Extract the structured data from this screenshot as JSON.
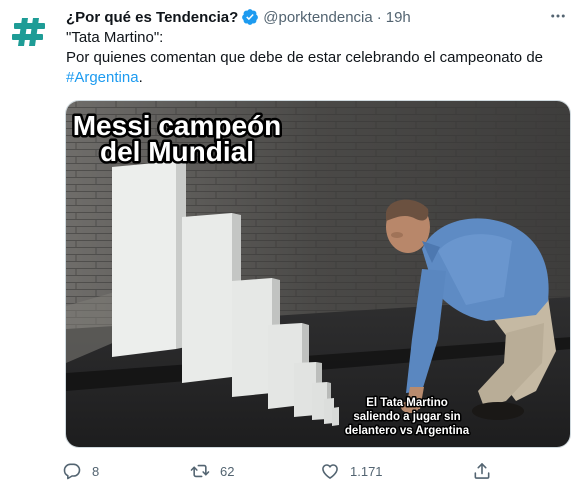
{
  "account": {
    "display_name": "¿Por qué es Tendencia?",
    "handle": "@porktendencia",
    "time": "19h",
    "avatar_icon": "hashtag-icon",
    "verified_icon": "verified-badge-icon",
    "brand_color": "#1d9bf0"
  },
  "tweet": {
    "title_line": "\"Tata Martino\":",
    "body_text": "Por quienes comentan que debe de estar celebrando el campeonato de",
    "hashtag": "#Argentina",
    "hashtag_suffix": "."
  },
  "media": {
    "caption_top_line1": "Messi campeón",
    "caption_top_line2": "del Mundial",
    "caption_bottom_line1": "El Tata Martino",
    "caption_bottom_line2": "saliendo a jugar sin",
    "caption_bottom_line3": "delantero vs Argentina"
  },
  "actions": {
    "reply_count": "8",
    "retweet_count": "62",
    "like_count": "1.171",
    "reply_icon": "reply-icon",
    "retweet_icon": "retweet-icon",
    "like_icon": "heart-icon",
    "share_icon": "share-icon",
    "more_icon": "more-icon"
  }
}
